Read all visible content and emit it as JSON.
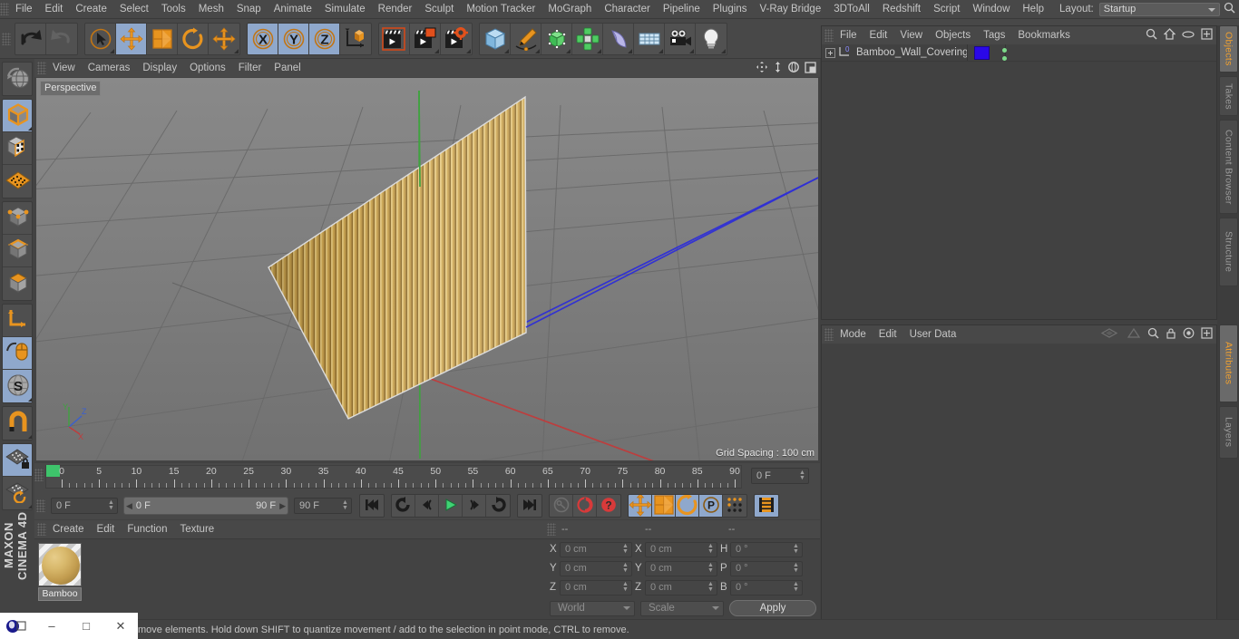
{
  "app": {
    "brand_line1": "MAXON",
    "brand_line2": "CINEMA 4D"
  },
  "menubar": {
    "items": [
      "File",
      "Edit",
      "Create",
      "Select",
      "Tools",
      "Mesh",
      "Snap",
      "Animate",
      "Simulate",
      "Render",
      "Sculpt",
      "Motion Tracker",
      "MoGraph",
      "Character",
      "Pipeline",
      "Plugins",
      "V-Ray Bridge",
      "3DToAll",
      "Redshift",
      "Script",
      "Window",
      "Help"
    ],
    "layout_label": "Layout:",
    "layout_value": "Startup",
    "search_icon": "search-icon"
  },
  "toolbar": {
    "groups": [
      {
        "name": "history",
        "buttons": [
          {
            "name": "undo-button",
            "icon": "undo-icon",
            "active": false,
            "corner": false
          },
          {
            "name": "redo-button",
            "icon": "redo-icon",
            "active": false,
            "corner": false
          }
        ]
      },
      {
        "name": "transform-tools",
        "buttons": [
          {
            "name": "live-selection-tool",
            "icon": "cursor-selection-icon",
            "active": false,
            "corner": true
          },
          {
            "name": "move-tool",
            "icon": "move-icon",
            "active": true,
            "corner": false
          },
          {
            "name": "scale-tool",
            "icon": "scale-icon",
            "active": false,
            "corner": false
          },
          {
            "name": "rotate-tool",
            "icon": "rotate-icon",
            "active": false,
            "corner": false
          },
          {
            "name": "free-move-tool",
            "icon": "move-icon",
            "active": false,
            "corner": true
          }
        ]
      },
      {
        "name": "axis-locks",
        "buttons": [
          {
            "name": "lock-x-axis-button",
            "icon": "x-axis-icon",
            "label": "X",
            "active": true,
            "corner": false
          },
          {
            "name": "lock-y-axis-button",
            "icon": "y-axis-icon",
            "label": "Y",
            "active": true,
            "corner": false
          },
          {
            "name": "lock-z-axis-button",
            "icon": "z-axis-icon",
            "label": "Z",
            "active": true,
            "corner": false
          },
          {
            "name": "world-object-coordinates-button",
            "icon": "world-axis-cube-icon",
            "active": false,
            "corner": false
          }
        ]
      },
      {
        "name": "render-tools",
        "buttons": [
          {
            "name": "render-view-button",
            "icon": "clapper-view-icon",
            "active": false,
            "corner": false
          },
          {
            "name": "render-to-picture-viewer-button",
            "icon": "clapper-picture-icon",
            "active": false,
            "corner": true
          },
          {
            "name": "render-settings-button",
            "icon": "clapper-gear-icon",
            "active": false,
            "corner": true
          }
        ]
      },
      {
        "name": "creation-tools",
        "buttons": [
          {
            "name": "add-cube-button",
            "icon": "cube-icon",
            "active": false,
            "corner": true
          },
          {
            "name": "add-spline-button",
            "icon": "pen-spline-icon",
            "active": false,
            "corner": true
          },
          {
            "name": "add-generator-button",
            "icon": "green-cube-generator-icon",
            "active": false,
            "corner": true
          },
          {
            "name": "add-array-button",
            "icon": "green-array-icon",
            "active": false,
            "corner": true
          },
          {
            "name": "add-deformer-button",
            "icon": "bend-deformer-icon",
            "active": false,
            "corner": true
          },
          {
            "name": "add-environment-button",
            "icon": "floor-grid-icon",
            "active": false,
            "corner": true
          },
          {
            "name": "add-camera-button",
            "icon": "camera-icon",
            "active": false,
            "corner": true
          },
          {
            "name": "add-light-button",
            "icon": "light-bulb-icon",
            "active": false,
            "corner": true
          }
        ]
      }
    ]
  },
  "left_toolbar": {
    "groups": [
      {
        "name": "undo-view-group",
        "buttons": [
          {
            "name": "undo-view-button",
            "icon": "globe-undo-icon",
            "active": false,
            "corner": false
          }
        ]
      },
      {
        "name": "editable-group",
        "buttons": [
          {
            "name": "make-editable-button",
            "icon": "editable-cube-icon",
            "active": true,
            "corner": true
          },
          {
            "name": "texture-axis-button",
            "icon": "checker-cube-icon",
            "active": false,
            "corner": false
          },
          {
            "name": "viewport-solo-button",
            "icon": "orange-grid-plane-icon",
            "active": false,
            "corner": false
          }
        ]
      },
      {
        "name": "mode-group",
        "buttons": [
          {
            "name": "points-mode-button",
            "icon": "points-cube-icon",
            "active": false,
            "corner": false
          },
          {
            "name": "edges-mode-button",
            "icon": "edges-cube-icon",
            "active": false,
            "corner": false
          },
          {
            "name": "polygons-mode-button",
            "icon": "polygons-cube-icon",
            "active": false,
            "corner": false
          }
        ]
      },
      {
        "name": "axis-group",
        "buttons": [
          {
            "name": "enable-axis-button",
            "icon": "axis-l-icon",
            "active": false,
            "corner": false
          },
          {
            "name": "viewport-lock-button",
            "icon": "mouse-icon",
            "active": true,
            "corner": false
          },
          {
            "name": "soft-selection-button",
            "icon": "s-sphere-icon",
            "active": true,
            "corner": true
          }
        ]
      },
      {
        "name": "snap-group",
        "buttons": [
          {
            "name": "enable-snap-button",
            "icon": "magnet-icon",
            "active": false,
            "corner": true
          }
        ]
      },
      {
        "name": "workplane-group",
        "buttons": [
          {
            "name": "lock-workplane-button",
            "icon": "workplane-lock-icon",
            "active": true,
            "corner": false
          },
          {
            "name": "planar-workplane-button",
            "icon": "workplane-rotate-icon",
            "active": false,
            "corner": true
          }
        ]
      }
    ]
  },
  "viewport": {
    "menu_items": [
      "View",
      "Cameras",
      "Display",
      "Options",
      "Filter",
      "Panel"
    ],
    "right_icons": [
      "pan-icon",
      "dolly-icon",
      "rotate-view-icon",
      "maximize-viewport-icon"
    ],
    "perspective_label": "Perspective",
    "grid_spacing_label": "Grid Spacing : 100 cm",
    "axis_gizmo": {
      "y": "Y",
      "z": "Z",
      "x": "X"
    },
    "colors": {
      "background": "#7c7c7c",
      "grid_line": "#6b6b6b",
      "x_axis": "#c04040",
      "y_axis": "#3fa33f",
      "z_axis": "#3a3ad0",
      "model_light": "#e3c772",
      "model_mid": "#cfa84e",
      "model_dark": "#9c7b32"
    }
  },
  "timeline": {
    "tick_labels": [
      "0",
      "5",
      "10",
      "15",
      "20",
      "25",
      "30",
      "35",
      "40",
      "45",
      "50",
      "55",
      "60",
      "65",
      "70",
      "75",
      "80",
      "85",
      "90"
    ],
    "frame_min": 0,
    "frame_max": 90,
    "current_frame_field": "0 F"
  },
  "transport": {
    "current_frame": "0 F",
    "range_start": "0 F",
    "range_end": "90 F",
    "preview_end": "90 F",
    "buttons": [
      {
        "name": "go-to-start-button",
        "icon": "skip-start-icon",
        "active": false
      },
      {
        "name": "play-previous-frame-button",
        "icon": "step-back-loop-icon",
        "active": false
      },
      {
        "name": "go-to-previous-frame-button",
        "icon": "prev-frame-icon",
        "active": false
      },
      {
        "name": "play-button",
        "icon": "play-icon",
        "active": false
      },
      {
        "name": "go-to-next-frame-button",
        "icon": "next-frame-icon",
        "active": false
      },
      {
        "name": "play-forwards-button",
        "icon": "loop-forward-icon",
        "active": false
      },
      {
        "name": "go-to-end-button",
        "icon": "skip-end-icon",
        "active": false
      },
      {
        "name": "record-active-objects-button",
        "icon": "key-icon",
        "active": false
      },
      {
        "name": "autokeying-button",
        "icon": "red-circle-icon",
        "active": false
      },
      {
        "name": "keyframe-selection-button",
        "icon": "question-circle-icon",
        "active": false
      },
      {
        "name": "position-keying-button",
        "icon": "move-icon",
        "active": true
      },
      {
        "name": "scale-keying-button",
        "icon": "scale-icon",
        "active": true
      },
      {
        "name": "rotation-keying-button",
        "icon": "rotate-icon",
        "active": true
      },
      {
        "name": "parameter-keying-button",
        "icon": "p-circle-icon",
        "active": true
      },
      {
        "name": "point-level-animation-button",
        "icon": "dot-matrix-icon",
        "active": false
      },
      {
        "name": "timeline-toggle-button",
        "icon": "filmstrip-icon",
        "active": true
      }
    ]
  },
  "material_manager": {
    "menu_items": [
      "Create",
      "Edit",
      "Function",
      "Texture"
    ],
    "materials": [
      {
        "name": "Bamboo",
        "icon": "material-sphere-icon"
      }
    ]
  },
  "coordinates": {
    "header_cols": [
      "--",
      "--",
      "--"
    ],
    "rows": [
      {
        "pos_label": "X",
        "pos_value": "0 cm",
        "size_label": "X",
        "size_value": "0 cm",
        "rot_label": "H",
        "rot_value": "0 °"
      },
      {
        "pos_label": "Y",
        "pos_value": "0 cm",
        "size_label": "Y",
        "size_value": "0 cm",
        "rot_label": "P",
        "rot_value": "0 °"
      },
      {
        "pos_label": "Z",
        "pos_value": "0 cm",
        "size_label": "Z",
        "size_value": "0 cm",
        "rot_label": "B",
        "rot_value": "0 °"
      }
    ],
    "space_select": "World",
    "mode_select": "Scale",
    "apply_label": "Apply"
  },
  "object_manager": {
    "menu_items": [
      "File",
      "Edit",
      "View",
      "Objects",
      "Tags",
      "Bookmarks"
    ],
    "right_icons": [
      "search-icon",
      "home-icon",
      "ellipse-icon",
      "plus-box-icon"
    ],
    "objects": [
      {
        "name": "Bamboo_Wall_Covering",
        "layer_badge": "0",
        "material_color": "#2a08e8",
        "tag_dots": 2
      }
    ]
  },
  "attribute_manager": {
    "menu_items": [
      "Mode",
      "Edit",
      "User Data"
    ],
    "right_icons": [
      "history-back-icon",
      "history-forward-icon",
      "search-icon",
      "lock-icon",
      "target-icon",
      "plus-box-icon"
    ]
  },
  "right_tabs": [
    {
      "label": "Objects",
      "active": true
    },
    {
      "label": "Takes",
      "active": false
    },
    {
      "label": "Content Browser",
      "active": false
    },
    {
      "label": "Structure",
      "active": false
    },
    {
      "label": "Attributes",
      "active": true
    },
    {
      "label": "Layers",
      "active": false
    }
  ],
  "statusbar": {
    "message": "move elements. Hold down SHIFT to quantize movement / add to the selection in point mode, CTRL to remove."
  },
  "taskbar": {
    "buttons": [
      {
        "name": "app-icon",
        "glyph": "●"
      },
      {
        "name": "minimize-window-button",
        "glyph": "–"
      },
      {
        "name": "maximize-window-button",
        "glyph": "□"
      },
      {
        "name": "close-window-button",
        "glyph": "✕"
      }
    ]
  }
}
